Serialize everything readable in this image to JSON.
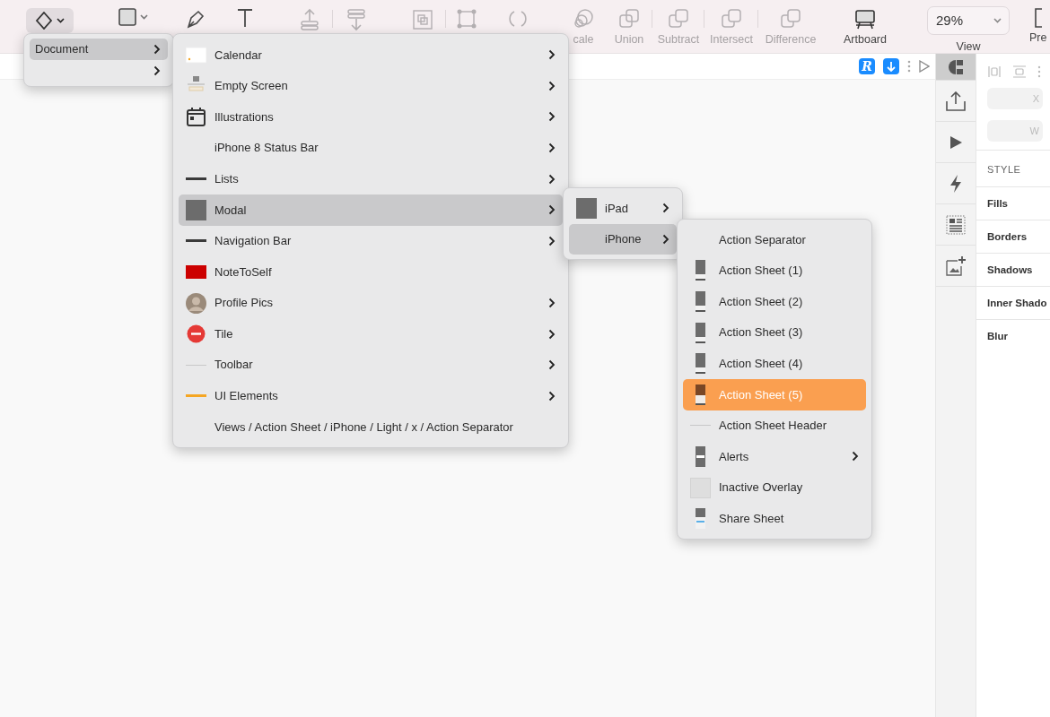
{
  "toolbar": {
    "items": [
      {
        "kind": "insert",
        "selected": true,
        "disabled": false,
        "separated": false
      },
      {
        "kind": "shape",
        "selected": false,
        "disabled": false,
        "separated": false
      },
      {
        "kind": "pen",
        "selected": false,
        "disabled": false,
        "separated": false
      },
      {
        "kind": "text",
        "selected": false,
        "disabled": false,
        "separated": false
      },
      {
        "kind": "align-up",
        "selected": false,
        "disabled": true,
        "separated": false
      },
      {
        "kind": "align-down",
        "selected": false,
        "disabled": true,
        "separated": true
      },
      {
        "kind": "group",
        "selected": false,
        "disabled": true,
        "separated": false
      },
      {
        "kind": "transform",
        "selected": false,
        "disabled": true,
        "separated": true
      },
      {
        "kind": "rotate",
        "selected": false,
        "disabled": true,
        "separated": false
      },
      {
        "kind": "scale",
        "label": "cale",
        "selected": false,
        "disabled": true,
        "separated": false
      },
      {
        "kind": "union",
        "label": "Union",
        "selected": false,
        "disabled": true,
        "separated": false
      },
      {
        "kind": "subtract",
        "label": "Subtract",
        "selected": false,
        "disabled": true,
        "separated": true
      },
      {
        "kind": "intersect",
        "label": "Intersect",
        "selected": false,
        "disabled": true,
        "separated": true
      },
      {
        "kind": "difference",
        "label": "Difference",
        "selected": false,
        "disabled": true,
        "separated": true
      },
      {
        "kind": "artboard",
        "label": "Artboard",
        "selected": false,
        "disabled": false,
        "separated": false
      },
      {
        "kind": "zoom",
        "label": "View",
        "value": "29%"
      },
      {
        "kind": "preview",
        "label": "Pre",
        "selected": false,
        "disabled": false,
        "separated": false
      }
    ]
  },
  "canvas_bar": {
    "badge_text": "R"
  },
  "menus": [
    {
      "items": [
        {
          "label": "Document",
          "selected": true,
          "submenu": true
        },
        {
          "selected": false,
          "submenu": true
        }
      ]
    },
    {
      "items": [
        {
          "label": "Calendar",
          "kind": "calendar-thumb",
          "selected": false,
          "submenu": true
        },
        {
          "label": "Empty Screen",
          "kind": "screen-thumb",
          "selected": false,
          "submenu": true
        },
        {
          "label": "Illustrations",
          "kind": "calendar",
          "selected": false,
          "submenu": true
        },
        {
          "label": "iPhone 8 Status Bar",
          "kind": "none",
          "selected": false,
          "submenu": true
        },
        {
          "label": "Lists",
          "kind": "dark-bar",
          "selected": false,
          "submenu": true
        },
        {
          "label": "Modal",
          "kind": "grey-square",
          "selected": true,
          "submenu": true
        },
        {
          "label": "Navigation Bar",
          "kind": "dark-bar",
          "selected": false,
          "submenu": true
        },
        {
          "label": "NoteToSelf",
          "kind": "red-rect",
          "selected": false,
          "submenu": false
        },
        {
          "label": "Profile Pics",
          "kind": "avatar",
          "selected": false,
          "submenu": true
        },
        {
          "label": "Tile",
          "kind": "stop",
          "selected": false,
          "submenu": true
        },
        {
          "label": "Toolbar",
          "kind": "light-bar",
          "selected": false,
          "submenu": true
        },
        {
          "label": "UI Elements",
          "kind": "orange-bar",
          "selected": false,
          "submenu": true
        },
        {
          "label": "Views / Action Sheet / iPhone / Light / x / Action Separator",
          "kind": "none",
          "selected": false,
          "submenu": false
        }
      ]
    },
    {
      "items": [
        {
          "label": "iPad",
          "kind": "grey-square",
          "selected": false,
          "submenu": true
        },
        {
          "label": "iPhone",
          "kind": "none",
          "selected": true,
          "submenu": true
        }
      ]
    },
    {
      "items": [
        {
          "label": "Action Separator",
          "kind": "none",
          "selected": false,
          "submenu": false
        },
        {
          "label": "Action Sheet (1)",
          "kind": "sheet",
          "selected": false,
          "submenu": false
        },
        {
          "label": "Action Sheet (2)",
          "kind": "sheet",
          "selected": false,
          "submenu": false
        },
        {
          "label": "Action Sheet (3)",
          "kind": "sheet",
          "selected": false,
          "submenu": false
        },
        {
          "label": "Action Sheet (4)",
          "kind": "sheet",
          "selected": false,
          "submenu": false
        },
        {
          "label": "Action Sheet (5)",
          "kind": "sheet",
          "selected": true,
          "submenu": false
        },
        {
          "label": "Action Sheet Header",
          "kind": "light-bar",
          "selected": false,
          "submenu": false
        },
        {
          "label": "Alerts",
          "kind": "alert",
          "selected": false,
          "submenu": true
        },
        {
          "label": "Inactive Overlay",
          "kind": "overlay",
          "selected": false,
          "submenu": false
        },
        {
          "label": "Share Sheet",
          "kind": "share",
          "selected": false,
          "submenu": false
        }
      ]
    }
  ],
  "side_tabs": [
    {
      "kind": "component",
      "selected": true
    },
    {
      "kind": "export",
      "selected": false
    },
    {
      "kind": "play",
      "selected": false
    },
    {
      "kind": "bolt",
      "selected": false
    },
    {
      "kind": "layout",
      "selected": false
    },
    {
      "kind": "image-add",
      "selected": false
    }
  ],
  "inspector": {
    "fields": [
      {
        "placeholder": "X"
      },
      {
        "placeholder": "W"
      }
    ],
    "style_heading": "STYLE",
    "sections": [
      "Fills",
      "Borders",
      "Shadows",
      "Inner Shado",
      "Blur"
    ]
  }
}
